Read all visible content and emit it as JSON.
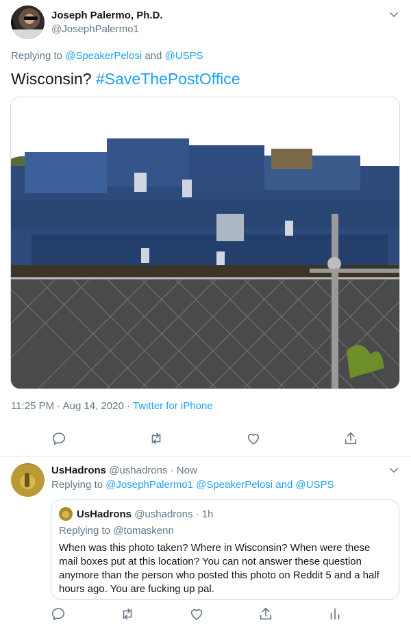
{
  "tweet": {
    "display_name": "Joseph Palermo, Ph.D.",
    "handle": "@JosephPalermo1",
    "replying_prefix": "Replying to ",
    "replying_user1": "@SpeakerPelosi",
    "replying_and": " and ",
    "replying_user2": "@USPS",
    "text": "Wisconsin? ",
    "hashtag": "#SaveThePostOffice",
    "time": "11:25 PM · Aug 14, 2020 · ",
    "source": "Twitter for iPhone",
    "photo_icon": "photo-mailboxes-behind-fence"
  },
  "reply": {
    "display_name": "UsHadrons",
    "handle_time": " @ushadrons · Now",
    "replying_prefix": "Replying to ",
    "replying_users": "@JosephPalermo1 @SpeakerPelosi and @USPS",
    "quote": {
      "display_name": "UsHadrons",
      "handle_time": " @ushadrons · 1h",
      "replying": "Replying to @tomaskenn",
      "text": "When was this photo taken? Where in Wisconsin? When were these mail boxes put at this location? You can not answer these question anymore than the person who posted this photo on Reddit 5 and a half hours ago. You are fucking up pal."
    }
  },
  "icons": {
    "reply": "reply-icon",
    "retweet": "retweet-icon",
    "like": "heart-icon",
    "share": "share-icon",
    "analytics": "analytics-icon",
    "more": "chevron-down-icon"
  },
  "colors": {
    "accent": "#1da1f2",
    "muted": "#657786",
    "text": "#14171a",
    "border": "#e6ecf0"
  }
}
